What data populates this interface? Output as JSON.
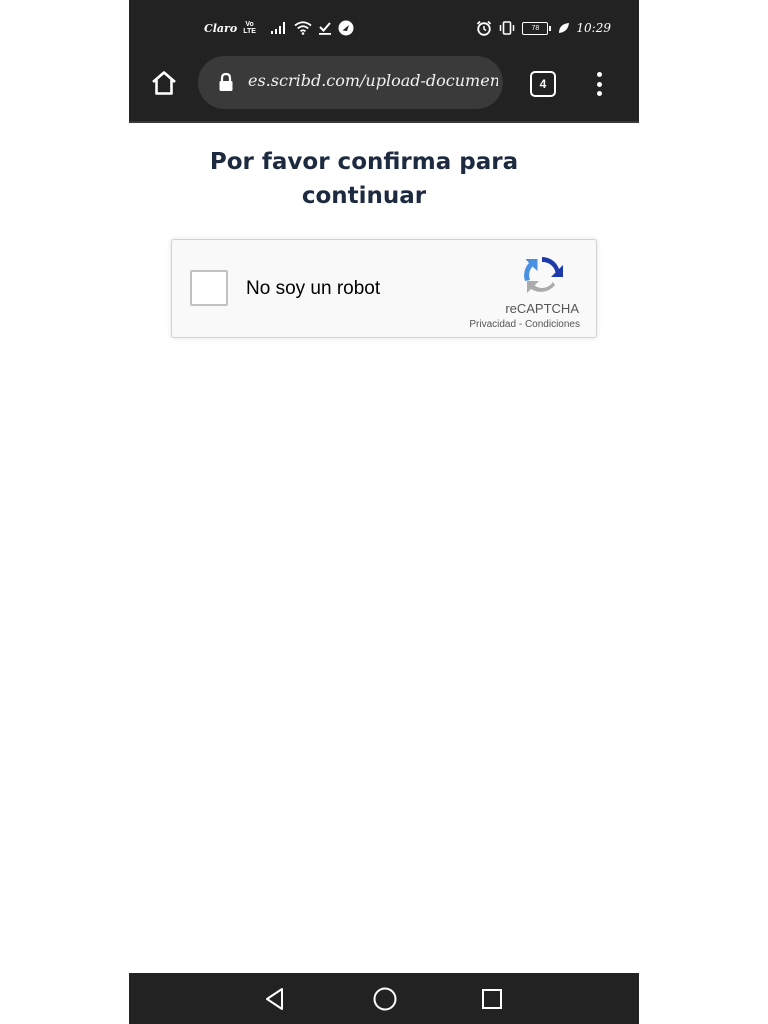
{
  "status_bar": {
    "carrier": "Claro",
    "volte_top": "Vo",
    "volte_bottom": "LTE",
    "battery": "78",
    "time": "10:29"
  },
  "toolbar": {
    "url": "es.scribd.com/upload-document",
    "tab_count": "4"
  },
  "page": {
    "title_line1": "Por favor confirma para",
    "title_line2": "continuar"
  },
  "recaptcha": {
    "label": "No soy un robot",
    "brand": "reCAPTCHA",
    "privacy": "Privacidad",
    "separator": " - ",
    "terms": "Condiciones"
  },
  "colors": {
    "chrome_bg": "#222222",
    "urlbar_bg": "#3a3a3a",
    "title_text": "#1e2a3f",
    "recaptcha_blue": "#1c3aa9",
    "recaptcha_lightblue": "#4a90e2",
    "recaptcha_gray": "#ababab"
  },
  "icons": {
    "home": "home-icon",
    "lock": "lock-icon",
    "tabs": "tab-switcher-icon",
    "menu": "more-vert-icon",
    "recaptcha": "recaptcha-logo-icon",
    "back": "nav-back-icon",
    "nav_home": "nav-home-icon",
    "recent": "nav-recents-icon"
  }
}
